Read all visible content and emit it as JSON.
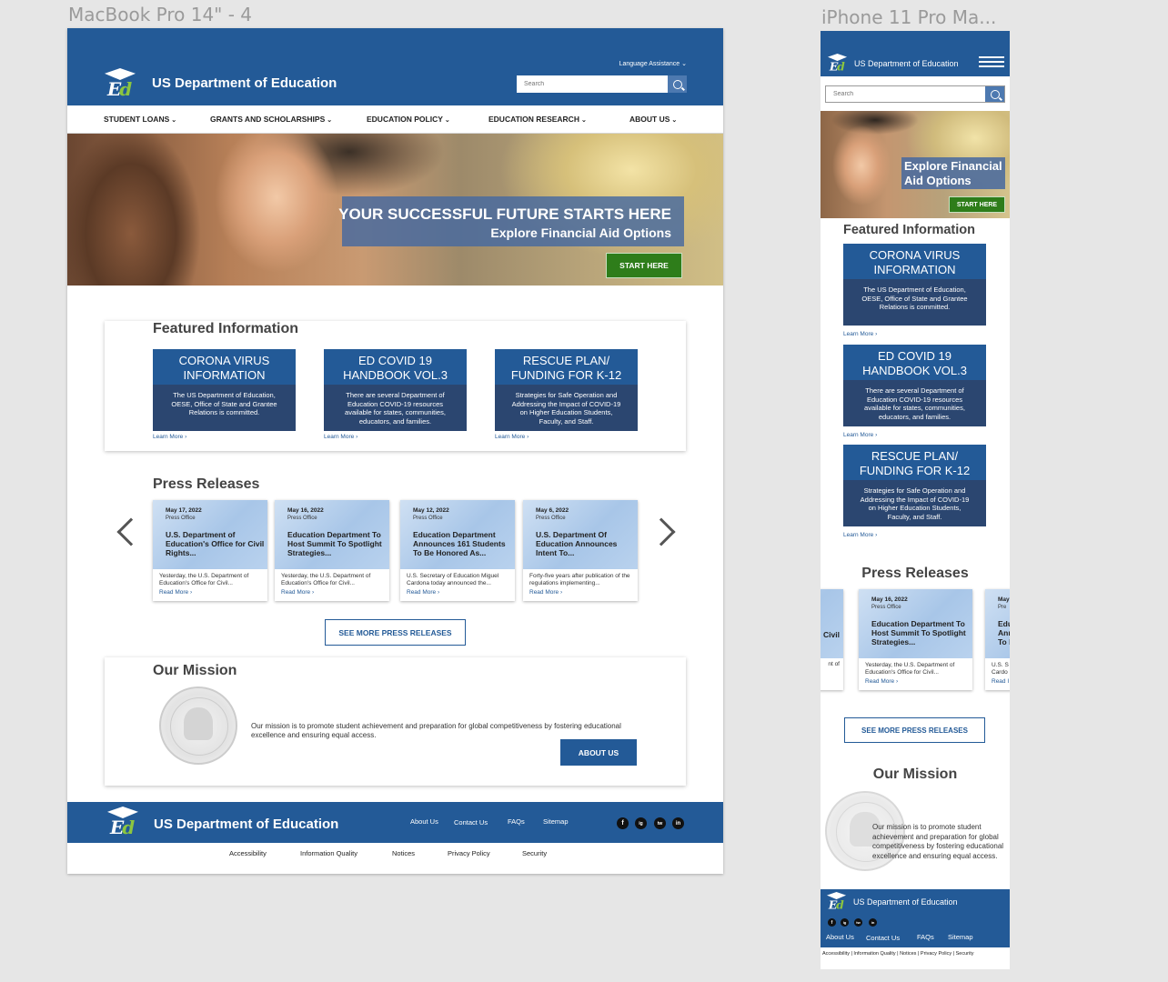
{
  "artboards": {
    "desktop_title": "MacBook Pro 14\" - 4",
    "mobile_title": "iPhone 11 Pro Ma..."
  },
  "brand": {
    "name": "US Department of Education",
    "logo_letters": "Ed",
    "primary_color": "#235a97",
    "accent_green": "#2e7d1a"
  },
  "header": {
    "language": "Language Assistance",
    "search_placeholder": "Search"
  },
  "nav": [
    {
      "label": "STUDENT LOANS"
    },
    {
      "label": "GRANTS AND SCHOLARSHIPS"
    },
    {
      "label": "EDUCATION POLICY"
    },
    {
      "label": "EDUCATION RESEARCH"
    },
    {
      "label": "ABOUT US"
    }
  ],
  "hero": {
    "title": "YOUR SUCCESSFUL FUTURE STARTS HERE",
    "subtitle": "Explore Financial Aid Options",
    "cta": "START HERE",
    "mobile_line1": "Explore Financial",
    "mobile_line2": "Aid Options"
  },
  "featured": {
    "title": "Featured Information",
    "learn_more": "Learn More",
    "cards": [
      {
        "title_1": "CORONA VIRUS",
        "title_2": "INFORMATION",
        "body": "The US Department of Education, OESE, Office of State and Grantee Relations is committed."
      },
      {
        "title_1": "ED COVID 19",
        "title_2": "HANDBOOK VOL.3",
        "body": "There are several Department of Education COVID-19 resources available for states, communities, educators, and families."
      },
      {
        "title_1": "RESCUE PLAN/",
        "title_2": "FUNDING FOR K-12",
        "body": "Strategies for Safe Operation and Addressing the Impact of COVID-19 on Higher Education Students, Faculty, and Staff."
      }
    ]
  },
  "press": {
    "title": "Press Releases",
    "read_more": "Read More",
    "see_more": "SEE MORE PRESS RELEASES",
    "items": [
      {
        "date": "May 17, 2022",
        "office": "Press Office",
        "headline": "U.S. Department of Education's Office for Civil Rights...",
        "desc": "Yesterday, the U.S. Department of Education's Office for Civil..."
      },
      {
        "date": "May 16, 2022",
        "office": "Press Office",
        "headline": "Education Department To Host Summit To Spotlight Strategies...",
        "desc": "Yesterday, the U.S. Department of Education's Office for Civil..."
      },
      {
        "date": "May 12, 2022",
        "office": "Press Office",
        "headline": "Education Department Announces 161 Students To Be Honored As...",
        "desc": "U.S. Secretary of Education Miguel Cardona today announced the..."
      },
      {
        "date": "May 6, 2022",
        "office": "Press Office",
        "headline": "U.S. Department Of Education Announces Intent To...",
        "desc": "Forty-five years after publication of the regulations implementing..."
      }
    ],
    "mobile_partial": {
      "left_headline": "Civil",
      "left_desc": "nt of",
      "right_date": "May",
      "right_office": "Pre",
      "right_headline_1": "Edu",
      "right_headline_2": "Ann",
      "right_headline_3": "To B",
      "right_desc_1": "U.S. S",
      "right_desc_2": "Cardo",
      "right_read": "Read I"
    }
  },
  "mission": {
    "title": "Our Mission",
    "text": "Our mission is to promote student achievement and preparation for global competitiveness by fostering educational excellence and ensuring equal access.",
    "cta": "ABOUT US"
  },
  "footer": {
    "links": [
      "About Us",
      "Contact Us",
      "FAQs",
      "Sitemap"
    ],
    "social": [
      "f",
      "ig",
      "tw",
      "in"
    ],
    "sub_links": [
      "Accessibility",
      "Information Quality",
      "Notices",
      "Privacy Policy",
      "Security"
    ],
    "mobile_sub": "Accessibility | Information Quality | Notices | Privacy Policy | Security"
  }
}
